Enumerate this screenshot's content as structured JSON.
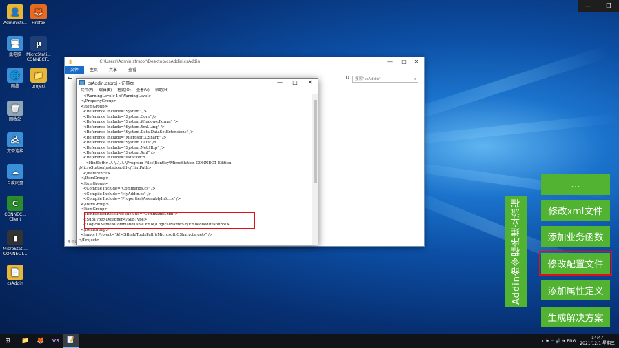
{
  "desktop_icons": [
    {
      "label": "Administr...",
      "color": "#e8b73a",
      "glyph": "👤"
    },
    {
      "label": "Firefox",
      "color": "#e66a1f",
      "glyph": "🦊"
    },
    {
      "label": "此电脑",
      "color": "#3a8fd9",
      "glyph": "🖥"
    },
    {
      "label": "MicroStati... CONNECT...",
      "color": "#1d3f78",
      "glyph": "μ"
    },
    {
      "label": "网络",
      "color": "#3a8fd9",
      "glyph": "🌐"
    },
    {
      "label": "project",
      "color": "#e8b73a",
      "glyph": "📁"
    },
    {
      "label": "回收站",
      "color": "#8fa5b8",
      "glyph": "🗑"
    },
    {
      "label": "宽带连接",
      "color": "#3a8fd9",
      "glyph": "🖧"
    },
    {
      "label": "百度网盘",
      "color": "#3a8fd9",
      "glyph": "☁"
    },
    {
      "label": "CONNEC... Client",
      "color": "#2a8c2a",
      "glyph": "C"
    },
    {
      "label": "MicroStati... CONNECT...",
      "color": "#333333",
      "glyph": "▮"
    },
    {
      "label": "csAddin",
      "color": "#e8b73a",
      "glyph": "📄"
    }
  ],
  "explorer": {
    "path": "C:\\Users\\Administrator\\Desktop\\csAddin\\csAddin",
    "tabs": [
      "文件",
      "主页",
      "共享",
      "查看"
    ],
    "search_placeholder": "搜索\"csAddin\"",
    "status": "8 个项目"
  },
  "notepad": {
    "title": "csAddin.csproj - 记事本",
    "menu": [
      "文件(F)",
      "编辑(E)",
      "格式(O)",
      "查看(V)",
      "帮助(H)"
    ],
    "lines": [
      "    <WarningLevel>4</WarningLevel>",
      "  </PropertyGroup>",
      "  <ItemGroup>",
      "    <Reference Include=\"System\" />",
      "    <Reference Include=\"System.Core\" />",
      "    <Reference Include=\"System.Windows.Forms\" />",
      "    <Reference Include=\"System.Xml.Linq\" />",
      "    <Reference Include=\"System.Data.DataSetExtensions\" />",
      "    <Reference Include=\"Microsoft.CSharp\" />",
      "    <Reference Include=\"System.Data\" />",
      "    <Reference Include=\"System.Net.Http\" />",
      "    <Reference Include=\"System.Xml\" />",
      "    <Reference Include=\"ustation\">",
      "      <HintPath>..\\..\\..\\..\\..\\Program Files\\Bentley\\MicroStation CONNECT Edition",
      "\\MicroStation\\ustation.dll</HintPath>",
      "    </Reference>",
      "  </ItemGroup>",
      "  <ItemGroup>",
      "    <Compile Include=\"Commands.cs\" />",
      "    <Compile Include=\"MyAddin.cs\" />",
      "    <Compile Include=\"Properties\\AssemblyInfo.cs\" />",
      "  </ItemGroup>",
      "  <ItemGroup>",
      "    <EmbeddedResource Include=\"Commands.xml\">",
      "    <SubType>Designer</SubType>",
      "    <LogicalName>CommandTable.xml</LogicalName></EmbeddedResource>",
      "  </ItemGroup>",
      "  <Import Project=\"$(MSBuildToolsPath)\\Microsoft.CSharp.targets\" />",
      "</Project>"
    ]
  },
  "flow": {
    "title": "Addin命令程序建立流程",
    "steps": [
      "…",
      "修改xml文件",
      "添加业务函数",
      "修改配置文件",
      "添加属性定义",
      "生成解决方案"
    ],
    "highlight_index": 3,
    "accent": "#52b332",
    "highlight_color": "#e0101a"
  },
  "taskbar": {
    "items": [
      "⊞",
      "📁",
      "🦊",
      "VS",
      "📝"
    ],
    "tray": "∧  ⚑  ▭  🔊  ✈  ENG",
    "time": "14:47",
    "date": "2021/12/1 星期三"
  }
}
